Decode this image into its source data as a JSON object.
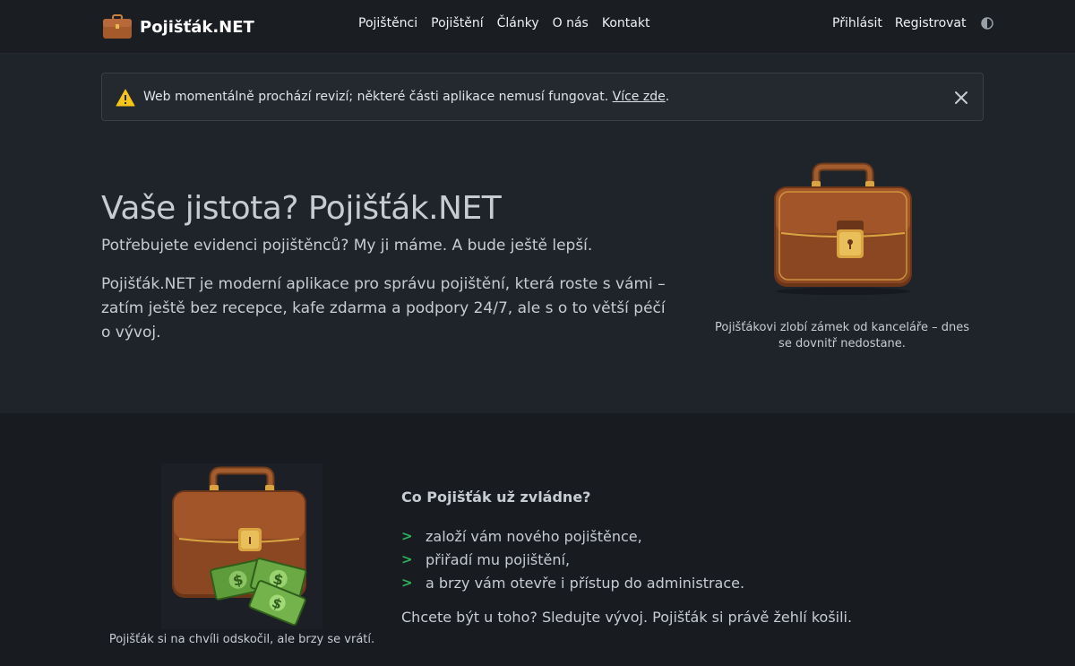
{
  "brand": {
    "name": "Pojišťák.NET",
    "logo_icon": "briefcase-icon"
  },
  "nav": {
    "links": [
      "Pojištěnci",
      "Pojištění",
      "Články",
      "O nás",
      "Kontakt"
    ],
    "login": "Přihlásit",
    "register": "Registrovat",
    "theme_icon": "half-circle-icon"
  },
  "alert": {
    "icon": "warning-icon",
    "text": "Web momentálně prochází revizí; některé části aplikace nemusí fungovat. ",
    "link": "Více zde",
    "suffix": ".",
    "close_icon": "close-icon"
  },
  "hero": {
    "title": "Vaše jistota? Pojišťák.NET",
    "lead": "Potřebujete evidenci pojištěnců? My ji máme. A bude ještě lepší.",
    "body": "Pojišťák.NET je moderní aplikace pro správu pojištění, která roste s vámi – zatím ještě bez recepce, kafe zdarma a podpory 24/7, ale s o to větší péčí o vývoj.",
    "image_icon": "briefcase-icon",
    "caption": "Pojišťákovi zlobí zámek od kanceláře – dnes se dovnitř nedostane."
  },
  "features": {
    "image_icon": "briefcase-money-icon",
    "caption": "Pojišťák si na chvíli odskočil, ale brzy se vrátí.",
    "heading": "Co Pojišťák už zvládne?",
    "bullet": ">",
    "items": [
      "založí vám nového pojištěnce,",
      "přiřadí mu pojištění,",
      "a brzy vám otevře i přístup do administrace."
    ],
    "outro": "Chcete být u toho? Sledujte vývoj. Pojišťák si právě žehlí košili."
  },
  "colors": {
    "background": "#1f232a",
    "navbar": "#1a1d22",
    "section_alt": "#181b20",
    "bullet_green": "#2fb35c",
    "warning_yellow": "#f5c518"
  }
}
